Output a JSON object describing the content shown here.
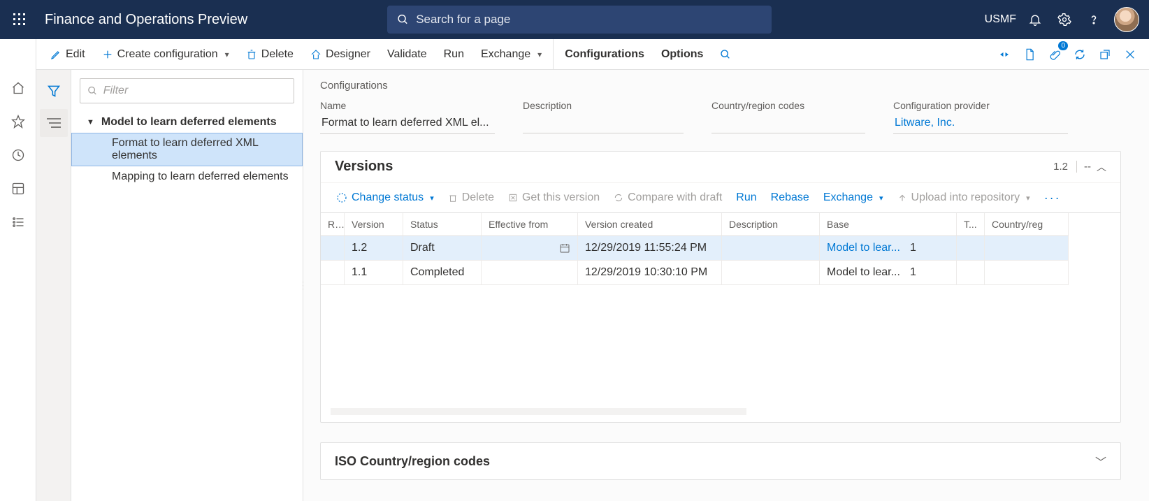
{
  "header": {
    "app_title": "Finance and Operations Preview",
    "search_placeholder": "Search for a page",
    "entity": "USMF"
  },
  "cmdbar": {
    "edit": "Edit",
    "create": "Create configuration",
    "delete": "Delete",
    "designer": "Designer",
    "validate": "Validate",
    "run": "Run",
    "exchange": "Exchange",
    "configurations": "Configurations",
    "options": "Options"
  },
  "tree": {
    "filter_placeholder": "Filter",
    "root": "Model to learn deferred elements",
    "children": [
      "Format to learn deferred XML elements",
      "Mapping to learn deferred elements"
    ],
    "selected_index": 0
  },
  "breadcrumb": "Configurations",
  "form": {
    "name_label": "Name",
    "name_value": "Format to learn deferred XML el...",
    "desc_label": "Description",
    "desc_value": "",
    "crc_label": "Country/region codes",
    "crc_value": "",
    "provider_label": "Configuration provider",
    "provider_value": "Litware, Inc."
  },
  "versions": {
    "title": "Versions",
    "badge_num": "1.2",
    "badge_dash": "--",
    "cmd": {
      "change_status": "Change status",
      "delete": "Delete",
      "get": "Get this version",
      "compare": "Compare with draft",
      "run": "Run",
      "rebase": "Rebase",
      "exchange": "Exchange",
      "upload": "Upload into repository"
    },
    "columns": [
      "R...",
      "Version",
      "Status",
      "Effective from",
      "Version created",
      "Description",
      "Base",
      "T...",
      "Country/reg"
    ],
    "rows": [
      {
        "version": "1.2",
        "status": "Draft",
        "effective": "",
        "created": "12/29/2019 11:55:24 PM",
        "desc": "",
        "base": "Model to lear...",
        "baseNum": "1",
        "t": "",
        "cr": "",
        "link": true,
        "selected": true,
        "show_date_icon": true
      },
      {
        "version": "1.1",
        "status": "Completed",
        "effective": "",
        "created": "12/29/2019 10:30:10 PM",
        "desc": "",
        "base": "Model to lear...",
        "baseNum": "1",
        "t": "",
        "cr": "",
        "link": false,
        "selected": false,
        "show_date_icon": false
      }
    ]
  },
  "iso": {
    "title": "ISO Country/region codes"
  }
}
